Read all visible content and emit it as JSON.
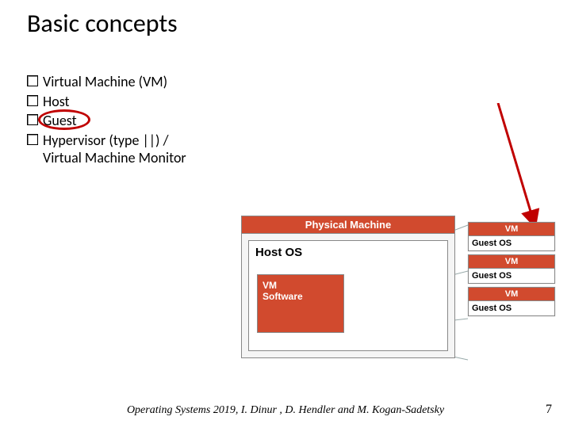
{
  "title": "Basic concepts",
  "bullets": [
    "Virtual Machine (VM)",
    "Host",
    "Guest",
    "Hypervisor (type ||) / Virtual Machine Monitor"
  ],
  "diagram": {
    "physical_machine": "Physical Machine",
    "host_os": "Host OS",
    "vm_software_l1": "VM",
    "vm_software_l2": "Software",
    "vm_hd": "VM",
    "guest_os": "Guest OS"
  },
  "footer": "Operating Systems 2019, I. Dinur , D. Hendler and M. Kogan-Sadetsky",
  "page": "7"
}
